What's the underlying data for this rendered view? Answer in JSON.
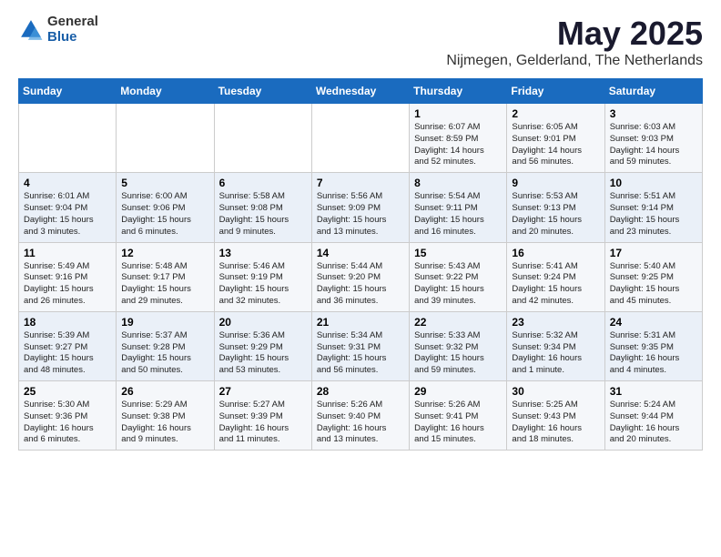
{
  "logo": {
    "general": "General",
    "blue": "Blue"
  },
  "title": "May 2025",
  "subtitle": "Nijmegen, Gelderland, The Netherlands",
  "days_of_week": [
    "Sunday",
    "Monday",
    "Tuesday",
    "Wednesday",
    "Thursday",
    "Friday",
    "Saturday"
  ],
  "weeks": [
    [
      {
        "day": "",
        "info": ""
      },
      {
        "day": "",
        "info": ""
      },
      {
        "day": "",
        "info": ""
      },
      {
        "day": "",
        "info": ""
      },
      {
        "day": "1",
        "info": "Sunrise: 6:07 AM\nSunset: 8:59 PM\nDaylight: 14 hours\nand 52 minutes."
      },
      {
        "day": "2",
        "info": "Sunrise: 6:05 AM\nSunset: 9:01 PM\nDaylight: 14 hours\nand 56 minutes."
      },
      {
        "day": "3",
        "info": "Sunrise: 6:03 AM\nSunset: 9:03 PM\nDaylight: 14 hours\nand 59 minutes."
      }
    ],
    [
      {
        "day": "4",
        "info": "Sunrise: 6:01 AM\nSunset: 9:04 PM\nDaylight: 15 hours\nand 3 minutes."
      },
      {
        "day": "5",
        "info": "Sunrise: 6:00 AM\nSunset: 9:06 PM\nDaylight: 15 hours\nand 6 minutes."
      },
      {
        "day": "6",
        "info": "Sunrise: 5:58 AM\nSunset: 9:08 PM\nDaylight: 15 hours\nand 9 minutes."
      },
      {
        "day": "7",
        "info": "Sunrise: 5:56 AM\nSunset: 9:09 PM\nDaylight: 15 hours\nand 13 minutes."
      },
      {
        "day": "8",
        "info": "Sunrise: 5:54 AM\nSunset: 9:11 PM\nDaylight: 15 hours\nand 16 minutes."
      },
      {
        "day": "9",
        "info": "Sunrise: 5:53 AM\nSunset: 9:13 PM\nDaylight: 15 hours\nand 20 minutes."
      },
      {
        "day": "10",
        "info": "Sunrise: 5:51 AM\nSunset: 9:14 PM\nDaylight: 15 hours\nand 23 minutes."
      }
    ],
    [
      {
        "day": "11",
        "info": "Sunrise: 5:49 AM\nSunset: 9:16 PM\nDaylight: 15 hours\nand 26 minutes."
      },
      {
        "day": "12",
        "info": "Sunrise: 5:48 AM\nSunset: 9:17 PM\nDaylight: 15 hours\nand 29 minutes."
      },
      {
        "day": "13",
        "info": "Sunrise: 5:46 AM\nSunset: 9:19 PM\nDaylight: 15 hours\nand 32 minutes."
      },
      {
        "day": "14",
        "info": "Sunrise: 5:44 AM\nSunset: 9:20 PM\nDaylight: 15 hours\nand 36 minutes."
      },
      {
        "day": "15",
        "info": "Sunrise: 5:43 AM\nSunset: 9:22 PM\nDaylight: 15 hours\nand 39 minutes."
      },
      {
        "day": "16",
        "info": "Sunrise: 5:41 AM\nSunset: 9:24 PM\nDaylight: 15 hours\nand 42 minutes."
      },
      {
        "day": "17",
        "info": "Sunrise: 5:40 AM\nSunset: 9:25 PM\nDaylight: 15 hours\nand 45 minutes."
      }
    ],
    [
      {
        "day": "18",
        "info": "Sunrise: 5:39 AM\nSunset: 9:27 PM\nDaylight: 15 hours\nand 48 minutes."
      },
      {
        "day": "19",
        "info": "Sunrise: 5:37 AM\nSunset: 9:28 PM\nDaylight: 15 hours\nand 50 minutes."
      },
      {
        "day": "20",
        "info": "Sunrise: 5:36 AM\nSunset: 9:29 PM\nDaylight: 15 hours\nand 53 minutes."
      },
      {
        "day": "21",
        "info": "Sunrise: 5:34 AM\nSunset: 9:31 PM\nDaylight: 15 hours\nand 56 minutes."
      },
      {
        "day": "22",
        "info": "Sunrise: 5:33 AM\nSunset: 9:32 PM\nDaylight: 15 hours\nand 59 minutes."
      },
      {
        "day": "23",
        "info": "Sunrise: 5:32 AM\nSunset: 9:34 PM\nDaylight: 16 hours\nand 1 minute."
      },
      {
        "day": "24",
        "info": "Sunrise: 5:31 AM\nSunset: 9:35 PM\nDaylight: 16 hours\nand 4 minutes."
      }
    ],
    [
      {
        "day": "25",
        "info": "Sunrise: 5:30 AM\nSunset: 9:36 PM\nDaylight: 16 hours\nand 6 minutes."
      },
      {
        "day": "26",
        "info": "Sunrise: 5:29 AM\nSunset: 9:38 PM\nDaylight: 16 hours\nand 9 minutes."
      },
      {
        "day": "27",
        "info": "Sunrise: 5:27 AM\nSunset: 9:39 PM\nDaylight: 16 hours\nand 11 minutes."
      },
      {
        "day": "28",
        "info": "Sunrise: 5:26 AM\nSunset: 9:40 PM\nDaylight: 16 hours\nand 13 minutes."
      },
      {
        "day": "29",
        "info": "Sunrise: 5:26 AM\nSunset: 9:41 PM\nDaylight: 16 hours\nand 15 minutes."
      },
      {
        "day": "30",
        "info": "Sunrise: 5:25 AM\nSunset: 9:43 PM\nDaylight: 16 hours\nand 18 minutes."
      },
      {
        "day": "31",
        "info": "Sunrise: 5:24 AM\nSunset: 9:44 PM\nDaylight: 16 hours\nand 20 minutes."
      }
    ]
  ]
}
